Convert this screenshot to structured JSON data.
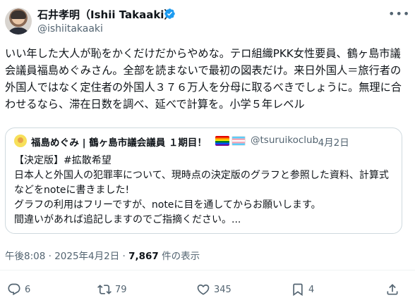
{
  "author": {
    "display_name": "石井孝明（Ishii Takaaki）",
    "handle": "@ishiitakaaki"
  },
  "tweet": {
    "text": "いい年した大人が恥をかくだけだからやめな。テロ組織PKK女性要員、鶴ヶ島市議会議員福島めぐみさん。全部を読まないで最初の図表だけ。来日外国人＝旅行者の外国人ではなく定住者の外国人３７６万人を分母に取るべきでしょうに。無理に合わせるなら、滞在日数を調べ、延べで計算を。小学５年レベル"
  },
  "quote": {
    "display_name": "福島めぐみ | 鶴ヶ島市議会議員 １期目！",
    "handle": "@tsuruikoclub",
    "date": "· 4月2日",
    "text": "【決定版】#拡散希望\n日本人と外国人の犯罪率について、現時点の決定版のグラフと参照した資料、計算式などをnoteに書きました!\nグラフの利用はフリーですが、noteに目を通してからお願いします。\n間違いがあれば追記しますのでご指摘ください。..."
  },
  "meta": {
    "time": "午後8:08 · 2025年4月2日 · ",
    "views_count": "7,867",
    "views_label": " 件の表示"
  },
  "actions": {
    "replies": "6",
    "reposts": "79",
    "likes": "345",
    "bookmarks": "4"
  },
  "colors": {
    "verified": "#1d9bf0",
    "secondary_text": "#536471",
    "border": "#cfd9de"
  },
  "icons": [
    "verified-badge-icon",
    "more-icon",
    "reply-icon",
    "retweet-icon",
    "like-icon",
    "bookmark-icon",
    "share-icon"
  ]
}
